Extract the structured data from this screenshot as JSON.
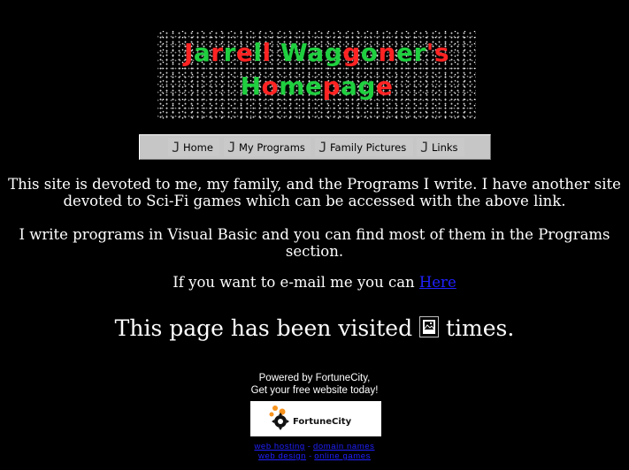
{
  "banner": {
    "line1": [
      {
        "t": "J",
        "c": "r"
      },
      {
        "t": "a",
        "c": "g"
      },
      {
        "t": "r",
        "c": "r"
      },
      {
        "t": "r",
        "c": "g"
      },
      {
        "t": "e",
        "c": "r"
      },
      {
        "t": "l",
        "c": "g"
      },
      {
        "t": "l",
        "c": "r"
      },
      {
        "t": " ",
        "c": "g"
      },
      {
        "t": "W",
        "c": "g"
      },
      {
        "t": "a",
        "c": "g"
      },
      {
        "t": "g",
        "c": "g"
      },
      {
        "t": "g",
        "c": "r"
      },
      {
        "t": "o",
        "c": "g"
      },
      {
        "t": "n",
        "c": "r"
      },
      {
        "t": "e",
        "c": "g"
      },
      {
        "t": "r",
        "c": "g"
      },
      {
        "t": "'",
        "c": "r"
      },
      {
        "t": "s",
        "c": "r"
      }
    ],
    "line2": [
      {
        "t": "H",
        "c": "g"
      },
      {
        "t": "o",
        "c": "r"
      },
      {
        "t": "m",
        "c": "g"
      },
      {
        "t": "e",
        "c": "g"
      },
      {
        "t": "p",
        "c": "r"
      },
      {
        "t": "a",
        "c": "g"
      },
      {
        "t": "g",
        "c": "g"
      },
      {
        "t": "e",
        "c": "r"
      }
    ],
    "colors": {
      "r": "#ff2323",
      "g": "#1fcf3f"
    }
  },
  "nav": {
    "items": [
      {
        "label": "Home",
        "icon": "j-icon"
      },
      {
        "label": "My Programs",
        "icon": "j-icon"
      },
      {
        "label": "Family Pictures",
        "icon": "j-icon"
      },
      {
        "label": "Links",
        "icon": "j-icon"
      }
    ]
  },
  "content": {
    "para1_line1": "This site is devoted to me, my family, and the Programs I write. I have another site",
    "para1_line2": "devoted to Sci-Fi games which can be accessed with the above link.",
    "para2_line1": "I write programs in Visual Basic and you can find most of them in the Programs",
    "para2_line2": "section.",
    "email_prefix": "If you want to e-mail me you can ",
    "email_link": "Here",
    "visits_prefix": "This page has been visited ",
    "visits_suffix": " times."
  },
  "footer": {
    "powered_line1": "Powered by FortuneCity,",
    "powered_line2": "Get your free website today!",
    "logo_text": "FortuneCity",
    "links_row1": [
      "web hosting",
      "domain names"
    ],
    "links_row2": [
      "web design",
      "online games"
    ],
    "link_color": "#2020ff"
  }
}
